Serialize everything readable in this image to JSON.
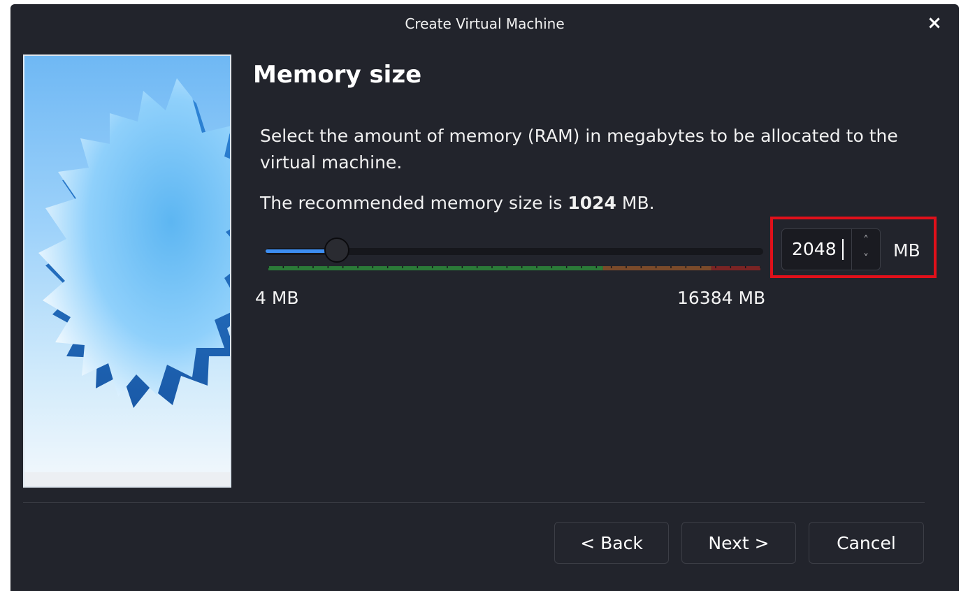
{
  "window": {
    "title": "Create Virtual Machine",
    "close_label": "×"
  },
  "page": {
    "heading": "Memory size",
    "description": "Select the amount of memory (RAM) in megabytes to be allocated to the virtual machine.",
    "recommendation_prefix": "The recommended memory size is ",
    "recommendation_value": "1024",
    "recommendation_suffix": " MB."
  },
  "memory": {
    "min_label": "4 MB",
    "max_label": "16384 MB",
    "min_mb": 4,
    "max_mb": 16384,
    "value_mb": 2048,
    "value_text": "2048",
    "unit": "MB",
    "up_arrow": "˄",
    "down_arrow": "˅",
    "accent_color": "#3d8ef2",
    "safe_color": "#2b7a38",
    "warn_color": "#7a4a2a",
    "danger_color": "#7a2424",
    "highlight_color": "#e0101a"
  },
  "buttons": {
    "back": "< Back",
    "next": "Next >",
    "cancel": "Cancel"
  }
}
